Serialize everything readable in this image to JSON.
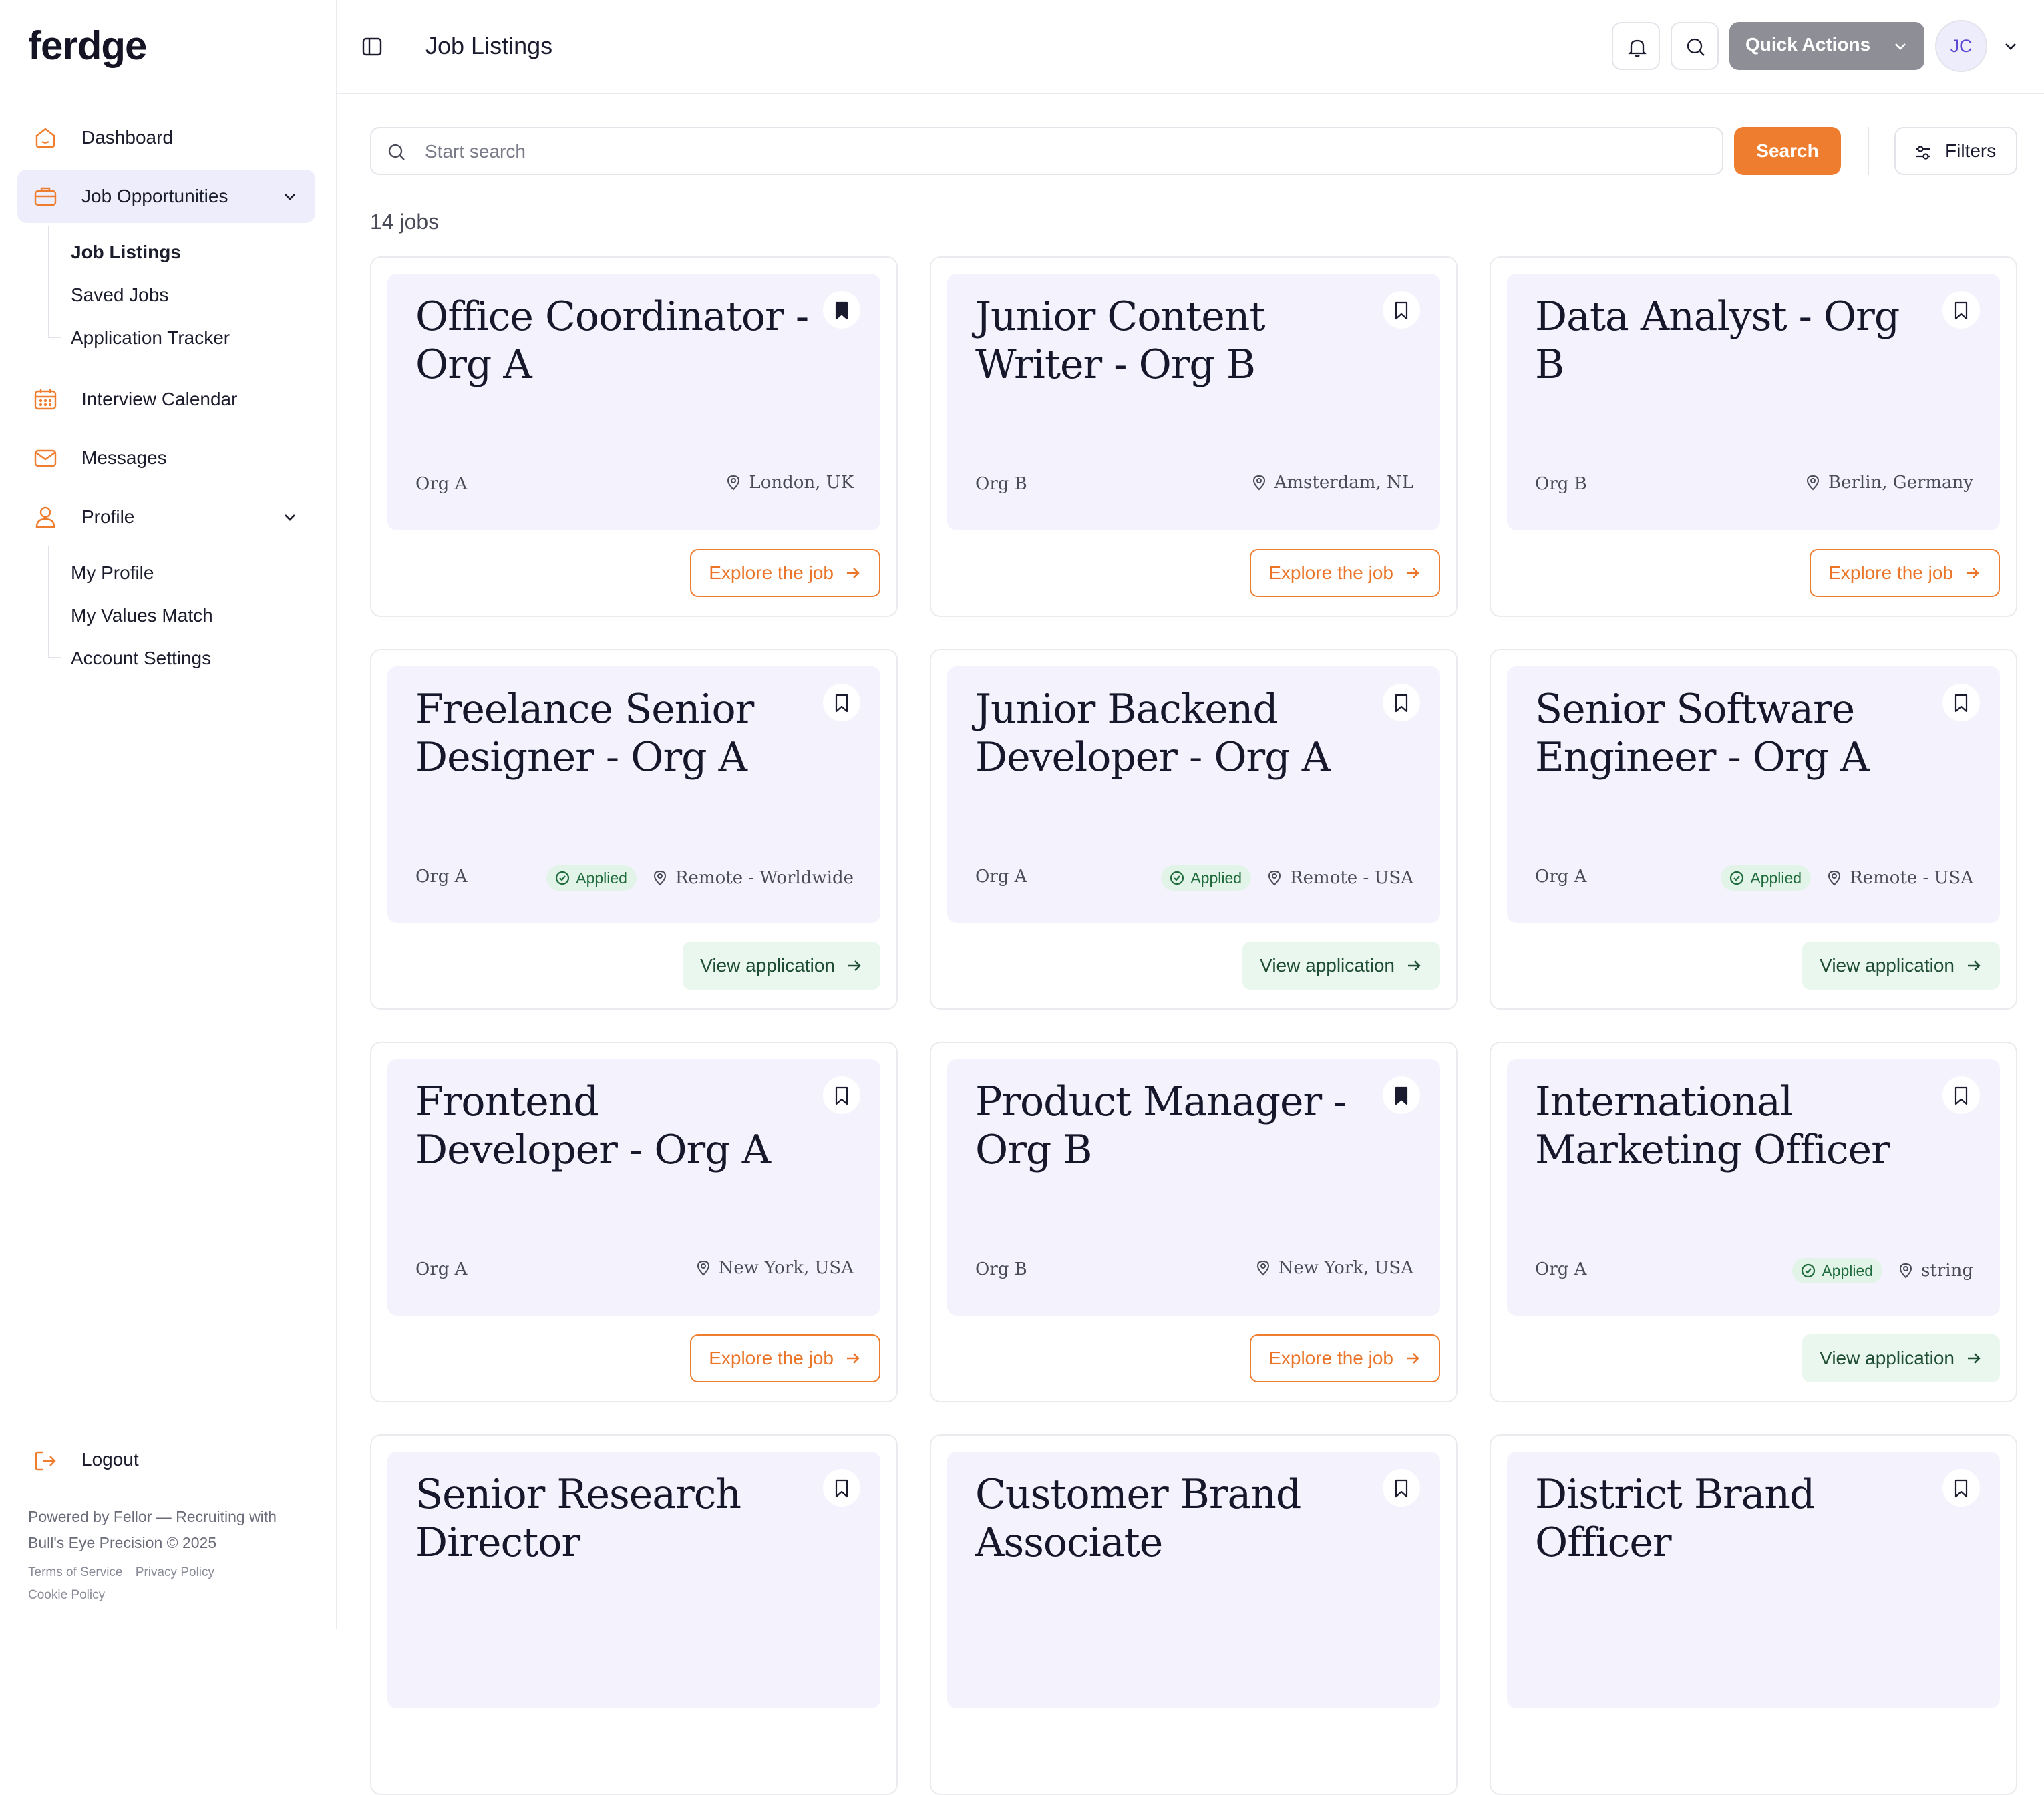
{
  "brand": {
    "logo": "ferdge",
    "accent": "#ef7d2f"
  },
  "sidebar": {
    "items": [
      {
        "label": "Dashboard",
        "icon": "home-icon"
      },
      {
        "label": "Job Opportunities",
        "icon": "briefcase-icon",
        "active": true,
        "expanded": true
      },
      {
        "label": "Interview Calendar",
        "icon": "calendar-icon"
      },
      {
        "label": "Messages",
        "icon": "mail-icon"
      },
      {
        "label": "Profile",
        "icon": "user-icon",
        "expanded": true
      }
    ],
    "job_sub": [
      "Job Listings",
      "Saved Jobs",
      "Application Tracker"
    ],
    "profile_sub": [
      "My Profile",
      "My Values Match",
      "Account Settings"
    ],
    "logout": "Logout",
    "footer": {
      "powered": "Powered by Fellor — Recruiting with Bull's Eye Precision © 2025",
      "terms": "Terms of Service",
      "privacy": "Privacy Policy",
      "cookie": "Cookie Policy"
    }
  },
  "header": {
    "title": "Job Listings",
    "quick_actions": "Quick Actions",
    "avatar_initials": "JC"
  },
  "search": {
    "placeholder": "Start search",
    "button": "Search",
    "filters": "Filters"
  },
  "count_label": "14 jobs",
  "jobs": [
    {
      "title": "Office Coordinator - Org A",
      "org": "Org A",
      "location": "London, UK",
      "applied": false,
      "saved": true,
      "action": "Explore the job"
    },
    {
      "title": "Junior Content Writer - Org B",
      "org": "Org B",
      "location": "Amsterdam, NL",
      "applied": false,
      "saved": false,
      "action": "Explore the job"
    },
    {
      "title": "Data Analyst - Org B",
      "org": "Org B",
      "location": "Berlin, Germany",
      "applied": false,
      "saved": false,
      "action": "Explore the job"
    },
    {
      "title": "Freelance Senior Designer - Org A",
      "org": "Org A",
      "location": "Remote - Worldwide",
      "applied": true,
      "saved": false,
      "action": "View application"
    },
    {
      "title": "Junior Backend Developer - Org A",
      "org": "Org A",
      "location": "Remote - USA",
      "applied": true,
      "saved": false,
      "action": "View application"
    },
    {
      "title": "Senior Software Engineer - Org A",
      "org": "Org A",
      "location": "Remote - USA",
      "applied": true,
      "saved": false,
      "action": "View application"
    },
    {
      "title": "Frontend Developer - Org A",
      "org": "Org A",
      "location": "New York, USA",
      "applied": false,
      "saved": false,
      "action": "Explore the job"
    },
    {
      "title": "Product Manager - Org B",
      "org": "Org B",
      "location": "New York, USA",
      "applied": false,
      "saved": true,
      "action": "Explore the job"
    },
    {
      "title": "International Marketing Officer",
      "org": "Org A",
      "location": "string",
      "applied": true,
      "saved": false,
      "action": "View application"
    },
    {
      "title": "Senior Research Director",
      "saved": false
    },
    {
      "title": "Customer Brand Associate",
      "saved": false
    },
    {
      "title": "District Brand Officer",
      "saved": false
    }
  ],
  "applied_label": "Applied"
}
